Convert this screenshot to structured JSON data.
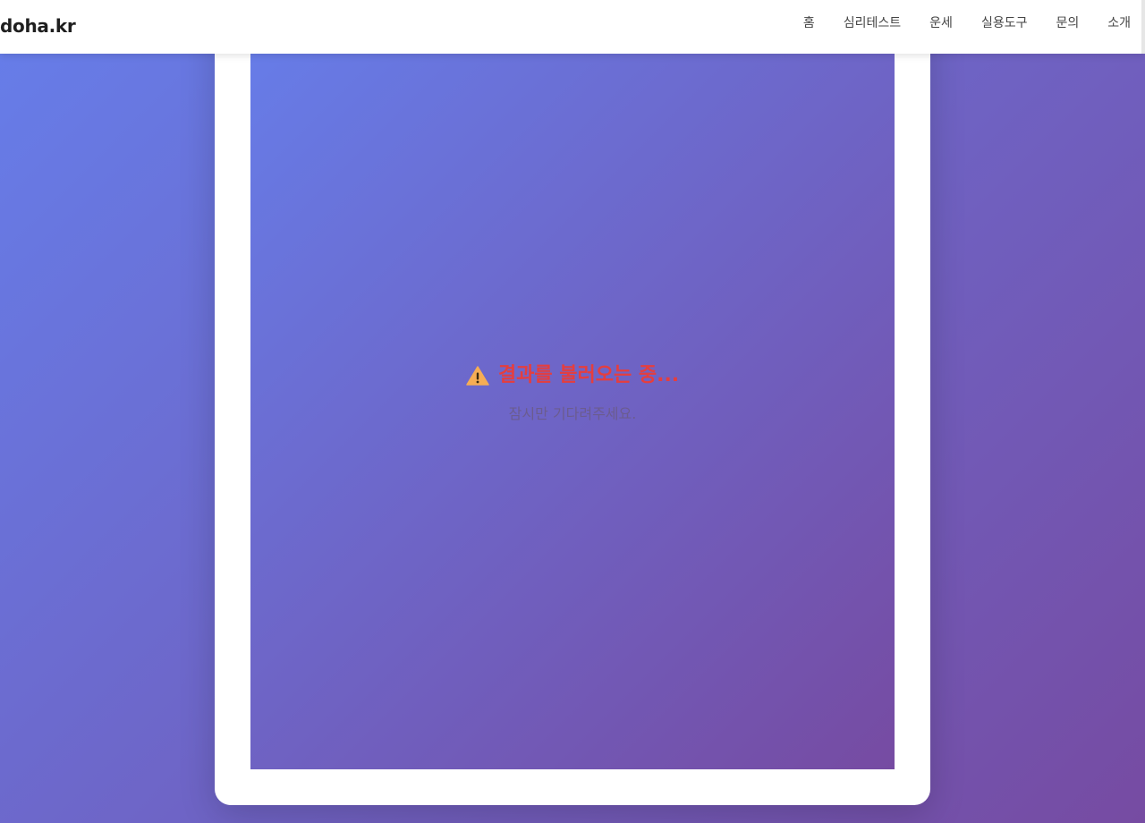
{
  "header": {
    "logo": "doha.kr",
    "nav": [
      {
        "label": "홈"
      },
      {
        "label": "심리테스트"
      },
      {
        "label": "운세"
      },
      {
        "label": "실용도구"
      },
      {
        "label": "문의"
      },
      {
        "label": "소개"
      }
    ]
  },
  "status": {
    "icon": "warning-icon",
    "title": "결과를 불러오는 중...",
    "subtitle": "잠시만 기다려주세요."
  },
  "colors": {
    "gradient_start": "#667eea",
    "gradient_end": "#764ba2",
    "title_color": "#e53e3e",
    "warning_icon": "#f6ad55"
  }
}
